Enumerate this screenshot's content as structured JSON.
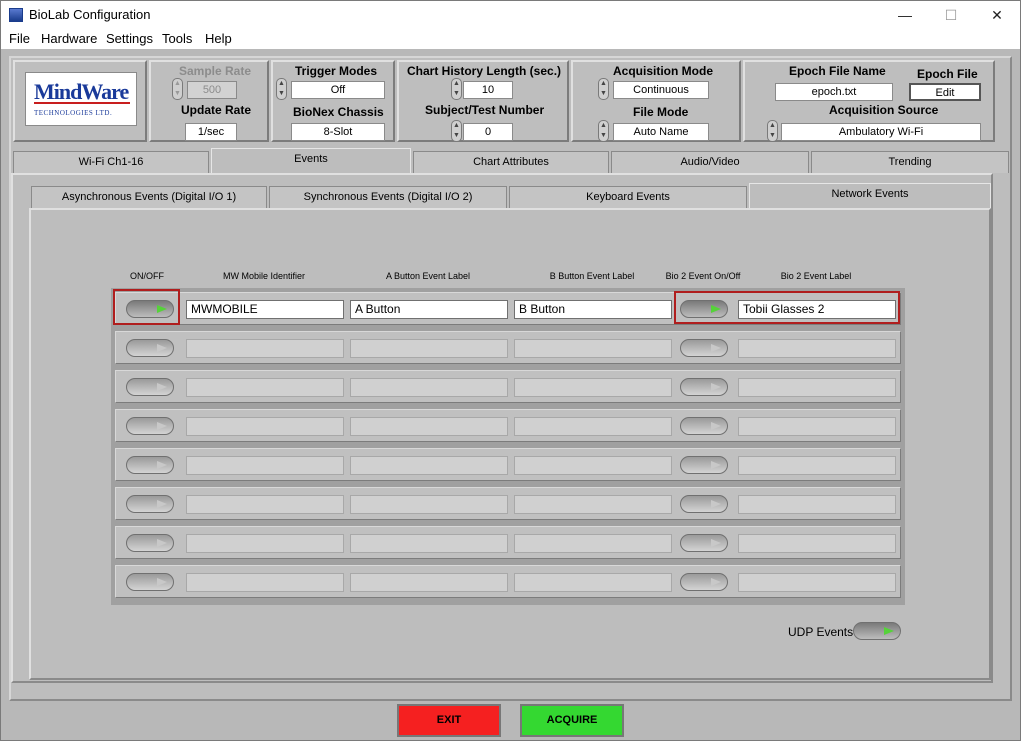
{
  "window": {
    "title": "BioLab Configuration",
    "minimize": "—",
    "maximize": "☐",
    "close": "✕"
  },
  "menu": [
    "File",
    "Hardware",
    "Settings",
    "Tools",
    "Help"
  ],
  "logo": {
    "line1": "MindWare",
    "line2": "TECHNOLOGIES LTD."
  },
  "controls": {
    "sample_rate": {
      "label": "Sample Rate",
      "value": "500"
    },
    "update_rate": {
      "label": "Update Rate",
      "value": "1/sec"
    },
    "trigger_modes": {
      "label": "Trigger Modes",
      "value": "Off"
    },
    "bionex_chassis": {
      "label": "BioNex Chassis",
      "value": "8-Slot"
    },
    "chart_history": {
      "label": "Chart History Length (sec.)",
      "value": "10"
    },
    "subject_number": {
      "label": "Subject/Test Number",
      "value": "0"
    },
    "acquisition_mode": {
      "label": "Acquisition Mode",
      "value": "Continuous"
    },
    "file_mode": {
      "label": "File Mode",
      "value": "Auto Name"
    },
    "epoch_file_name": {
      "label": "Epoch File Name",
      "value": "epoch.txt"
    },
    "epoch_file": {
      "label": "Epoch File",
      "button": "Edit"
    },
    "acquisition_source": {
      "label": "Acquisition Source",
      "value": "Ambulatory Wi-Fi"
    }
  },
  "tabs": [
    "Wi-Fi Ch1-16",
    "Events",
    "Chart Attributes",
    "Audio/Video",
    "Trending"
  ],
  "active_tab": "Events",
  "sub_tabs": [
    "Asynchronous Events (Digital I/O 1)",
    "Synchronous Events (Digital I/O 2)",
    "Keyboard Events",
    "Network Events"
  ],
  "active_sub_tab": "Network Events",
  "columns": [
    "ON/OFF",
    "MW Mobile Identifier",
    "A Button Event Label",
    "B Button Event Label",
    "Bio 2 Event On/Off",
    "Bio 2 Event Label"
  ],
  "rows": [
    {
      "on": true,
      "identifier": "MWMOBILE",
      "a_label": "A Button",
      "b_label": "B Button",
      "bio2_on": true,
      "bio2_label": "Tobii Glasses 2"
    },
    {
      "on": false,
      "identifier": "",
      "a_label": "",
      "b_label": "",
      "bio2_on": false,
      "bio2_label": ""
    },
    {
      "on": false,
      "identifier": "",
      "a_label": "",
      "b_label": "",
      "bio2_on": false,
      "bio2_label": ""
    },
    {
      "on": false,
      "identifier": "",
      "a_label": "",
      "b_label": "",
      "bio2_on": false,
      "bio2_label": ""
    },
    {
      "on": false,
      "identifier": "",
      "a_label": "",
      "b_label": "",
      "bio2_on": false,
      "bio2_label": ""
    },
    {
      "on": false,
      "identifier": "",
      "a_label": "",
      "b_label": "",
      "bio2_on": false,
      "bio2_label": ""
    },
    {
      "on": false,
      "identifier": "",
      "a_label": "",
      "b_label": "",
      "bio2_on": false,
      "bio2_label": ""
    },
    {
      "on": false,
      "identifier": "",
      "a_label": "",
      "b_label": "",
      "bio2_on": false,
      "bio2_label": ""
    }
  ],
  "udp_events": {
    "label": "UDP Events",
    "on": true
  },
  "buttons": {
    "exit": "EXIT",
    "acquire": "ACQUIRE"
  },
  "colors": {
    "exit": "#f52020",
    "acquire": "#34d831",
    "highlight": "#b01e1e",
    "led_on": "#56d23a"
  }
}
